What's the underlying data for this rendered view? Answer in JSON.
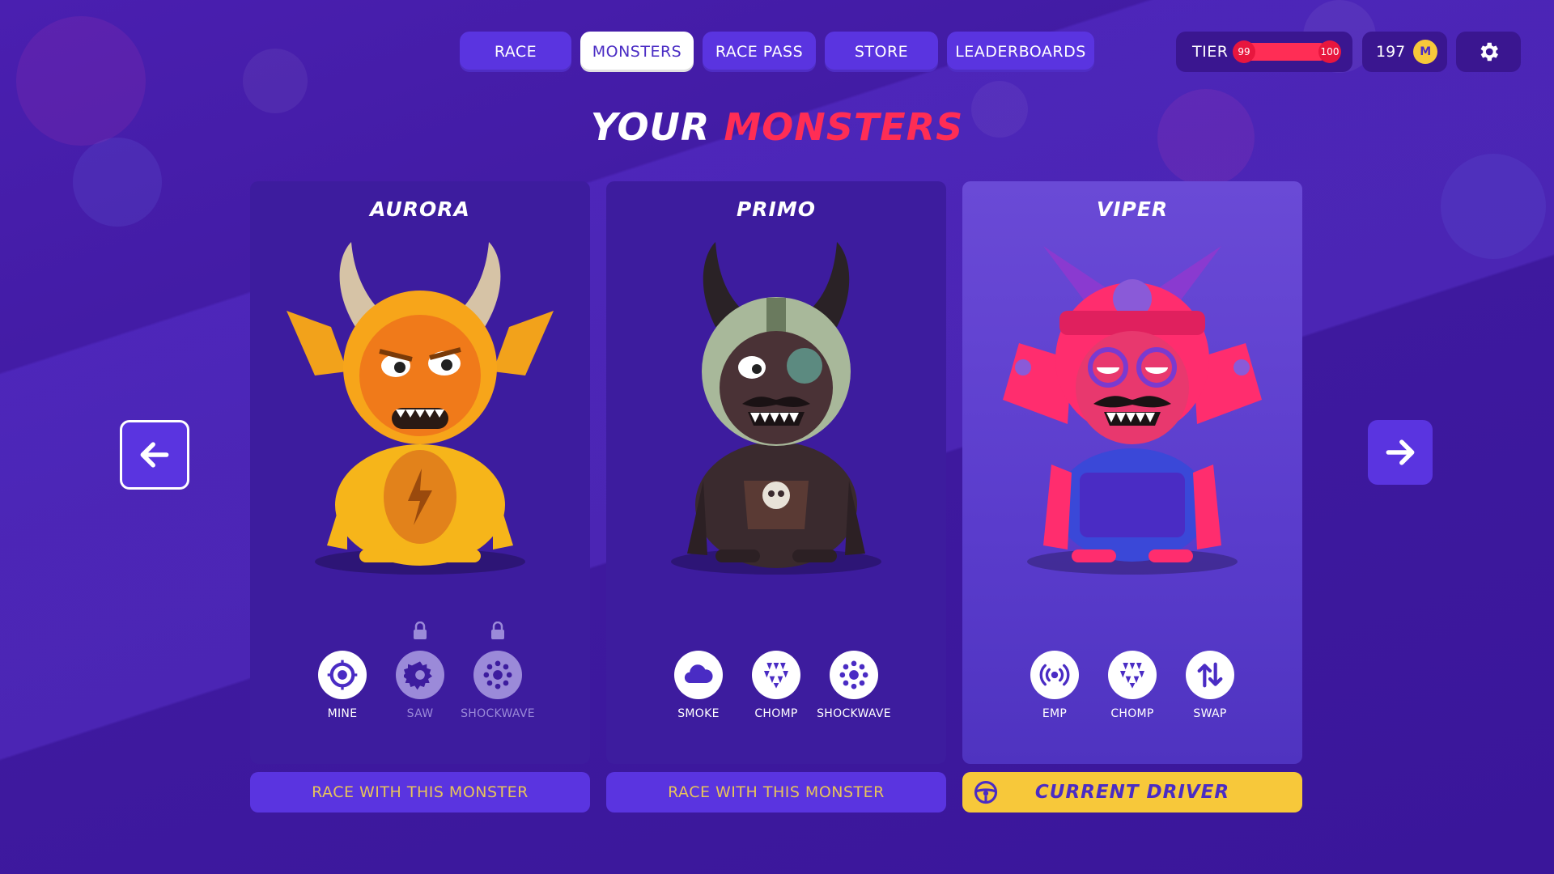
{
  "nav": {
    "tabs": [
      {
        "label": "RACE",
        "active": false
      },
      {
        "label": "MONSTERS",
        "active": true
      },
      {
        "label": "RACE PASS",
        "active": false
      },
      {
        "label": "STORE",
        "active": false
      },
      {
        "label": "LEADERBOARDS",
        "active": false
      }
    ]
  },
  "status": {
    "tier_label": "TIER",
    "tier_current": "99",
    "tier_next": "100",
    "tier_progress": 0.9,
    "coins": "197",
    "coin_icon": "coin-icon",
    "settings_icon": "gear-icon"
  },
  "title": {
    "main": "YOUR",
    "accent": "MONSTERS"
  },
  "colors": {
    "accent": "#ff2d55",
    "button": "#5a34e0",
    "gold": "#f7c83a",
    "card": "#3d1c9e"
  },
  "monsters": [
    {
      "name": "AURORA",
      "abilities": [
        {
          "label": "MINE",
          "icon": "mine-icon",
          "locked": false
        },
        {
          "label": "SAW",
          "icon": "saw-icon",
          "locked": true
        },
        {
          "label": "SHOCKWAVE",
          "icon": "shockwave-icon",
          "locked": true
        }
      ],
      "action": "RACE WITH THIS MONSTER"
    },
    {
      "name": "PRIMO",
      "abilities": [
        {
          "label": "SMOKE",
          "icon": "smoke-icon",
          "locked": false
        },
        {
          "label": "CHOMP",
          "icon": "chomp-icon",
          "locked": false
        },
        {
          "label": "SHOCKWAVE",
          "icon": "shockwave-icon",
          "locked": false
        }
      ],
      "action": "RACE WITH THIS MONSTER"
    },
    {
      "name": "VIPER",
      "abilities": [
        {
          "label": "EMP",
          "icon": "emp-icon",
          "locked": false
        },
        {
          "label": "CHOMP",
          "icon": "chomp-icon",
          "locked": false
        },
        {
          "label": "SWAP",
          "icon": "swap-icon",
          "locked": false
        }
      ],
      "action": "CURRENT DRIVER",
      "selected": true
    }
  ]
}
